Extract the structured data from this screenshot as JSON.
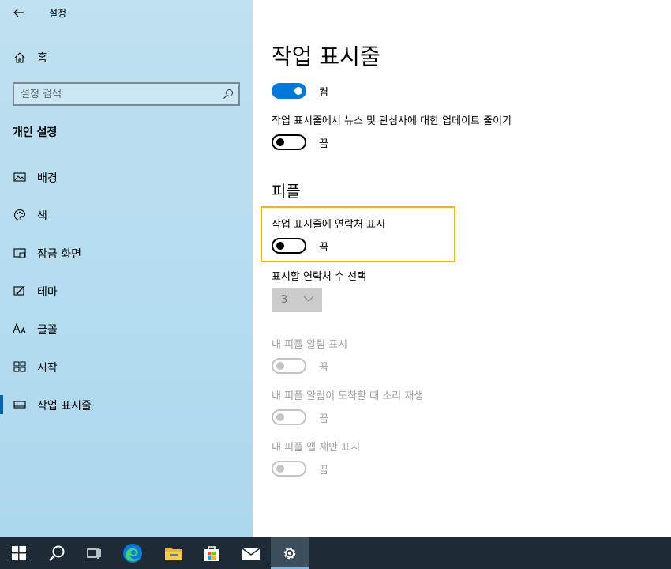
{
  "window": {
    "app_title": "설정",
    "back_icon": "arrow-left-icon"
  },
  "sidebar": {
    "home_label": "홈",
    "search_placeholder": "설정 검색",
    "section_title": "개인 설정",
    "items": [
      {
        "label": "배경",
        "icon": "image-icon",
        "selected": false
      },
      {
        "label": "색",
        "icon": "palette-icon",
        "selected": false
      },
      {
        "label": "잠금 화면",
        "icon": "lock-screen-icon",
        "selected": false
      },
      {
        "label": "테마",
        "icon": "theme-brush-icon",
        "selected": false
      },
      {
        "label": "글꼴",
        "icon": "font-icon",
        "selected": false
      },
      {
        "label": "시작",
        "icon": "start-tiles-icon",
        "selected": false
      },
      {
        "label": "작업 표시줄",
        "icon": "taskbar-icon",
        "selected": true
      }
    ]
  },
  "main": {
    "title": "작업 표시줄",
    "toggle1_state": "켬",
    "news_label": "작업 표시줄에서 뉴스 및 관심사에 대한 업데이트 줄이기",
    "news_state": "끔",
    "people_header": "피플",
    "show_contacts_label": "작업 표시줄에 연락처 표시",
    "show_contacts_state": "끔",
    "contacts_count_label": "표시할 연락처 수 선택",
    "contacts_count_value": "3",
    "notifications_label": "내 피플 알림 표시",
    "notifications_state": "끔",
    "sound_label": "내 피플 알림이 도착할 때 소리 재생",
    "sound_state": "끔",
    "suggestions_label": "내 피플 앱 제안 표시",
    "suggestions_state": "끔"
  },
  "taskbar": {
    "buttons": [
      "windows-start-icon",
      "search-icon",
      "task-view-icon",
      "edge-browser-icon",
      "file-explorer-icon",
      "microsoft-store-icon",
      "mail-icon",
      "settings-gear-icon"
    ],
    "active": "settings-gear-icon"
  },
  "colors": {
    "accent": "#0078d7",
    "highlight": "#f5b800",
    "sidebar_bg": "#b3dcf0",
    "taskbar_bg": "#1e2b36"
  }
}
